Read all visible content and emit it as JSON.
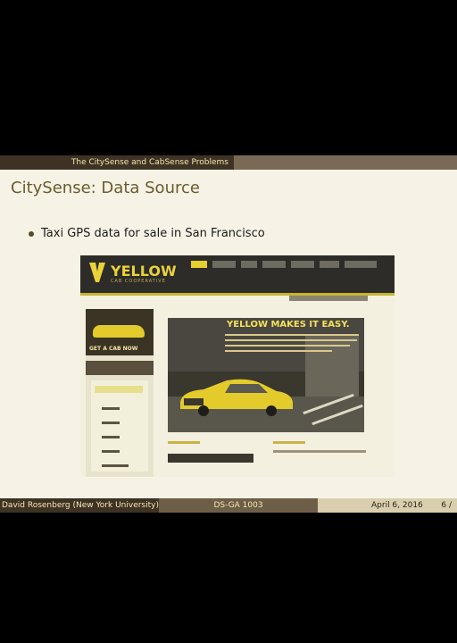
{
  "header": {
    "section": "The CitySense and CabSense Problems"
  },
  "slide": {
    "title": "CitySense: Data Source",
    "bullet": "Taxi GPS data for sale in San Francisco"
  },
  "screenshot": {
    "logo_text": "YELLOW",
    "logo_sub": "CAB COOPERATIVE",
    "promo_label": "GET A CAB NOW",
    "hero_headline": "YELLOW MAKES IT EASY."
  },
  "footer": {
    "author": "David Rosenberg  (New York University)",
    "course": "DS-GA 1003",
    "date": "April 6, 2016",
    "page": "6 /"
  },
  "colors": {
    "accent": "#e6cf2e",
    "bar_dark": "#3e3224",
    "slide_bg": "#f6f3e6"
  }
}
